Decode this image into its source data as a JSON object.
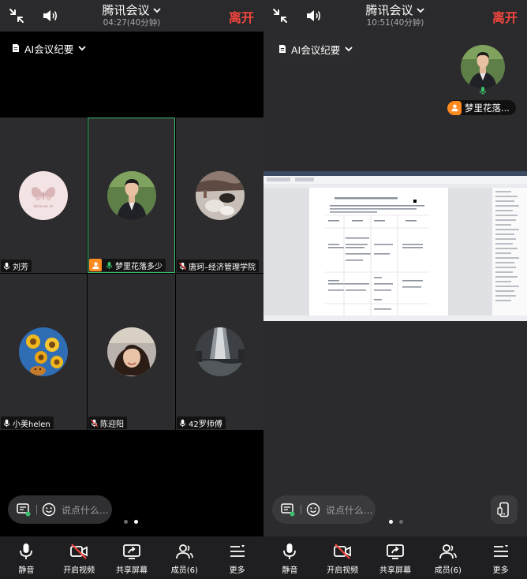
{
  "left": {
    "header": {
      "title": "腾讯会议",
      "time": "04:27(40分钟)",
      "leave": "离开"
    },
    "ai_button": "AI会议纪要",
    "participants": [
      {
        "name": "刘芳",
        "mic": "on",
        "active": false
      },
      {
        "name": "梦里花落多少",
        "mic": "on-green",
        "host": true,
        "active": true
      },
      {
        "name": "唐珂–经济管理学院",
        "mic": "muted",
        "active": false
      },
      {
        "name": "小美helen",
        "mic": "on",
        "active": false
      },
      {
        "name": "陈迎阳",
        "mic": "muted",
        "active": false
      },
      {
        "name": "42罗师傅",
        "mic": "on",
        "active": false
      }
    ],
    "chat_placeholder": "说点什么...",
    "page_dots": {
      "count": 2,
      "active": 1
    },
    "toolbar": [
      {
        "label": "静音",
        "icon": "mic-icon"
      },
      {
        "label": "开启视频",
        "icon": "video-off-icon"
      },
      {
        "label": "共享屏幕",
        "icon": "share-screen-icon"
      },
      {
        "label": "成员(6)",
        "icon": "members-icon"
      },
      {
        "label": "更多",
        "icon": "more-icon"
      }
    ]
  },
  "right": {
    "header": {
      "title": "腾讯会议",
      "time": "10:51(40分钟)",
      "leave": "离开"
    },
    "ai_button": "AI会议纪要",
    "speaker_name": "梦里花落...",
    "chat_placeholder": "说点什么...",
    "page_dots": {
      "count": 2,
      "active": 0
    },
    "toolbar": [
      {
        "label": "静音",
        "icon": "mic-icon"
      },
      {
        "label": "开启视频",
        "icon": "video-off-icon"
      },
      {
        "label": "共享屏幕",
        "icon": "share-screen-icon"
      },
      {
        "label": "成员(6)",
        "icon": "members-icon"
      },
      {
        "label": "更多",
        "icon": "more-icon"
      }
    ]
  },
  "colors": {
    "leave": "#f4453d",
    "active_border": "#39c06a",
    "host_badge": "#ff8a1f",
    "mic_active": "#39c06a"
  }
}
